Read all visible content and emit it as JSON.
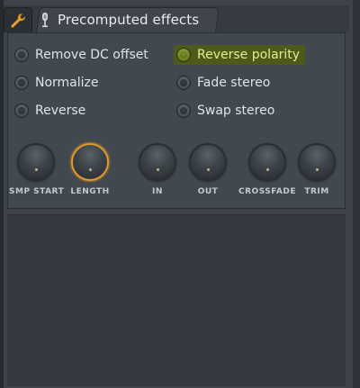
{
  "tabs": {
    "wrench_icon": "wrench-icon",
    "mic_icon": "microphone-icon",
    "title": "Precomputed effects"
  },
  "options": {
    "remove_dc": "Remove DC offset",
    "normalize": "Normalize",
    "reverse": "Reverse",
    "reverse_polarity": "Reverse polarity",
    "fade_stereo": "Fade stereo",
    "swap_stereo": "Swap stereo"
  },
  "knobs": {
    "smp_start": "SMP START",
    "length": "LENGTH",
    "in": "IN",
    "out": "OUT",
    "crossfade": "CROSSFADE",
    "trim": "TRIM"
  },
  "colors": {
    "highlight": "#4d5a1c",
    "active_knob_ring": "#e09a2b",
    "wrench": "#e8a33a"
  }
}
